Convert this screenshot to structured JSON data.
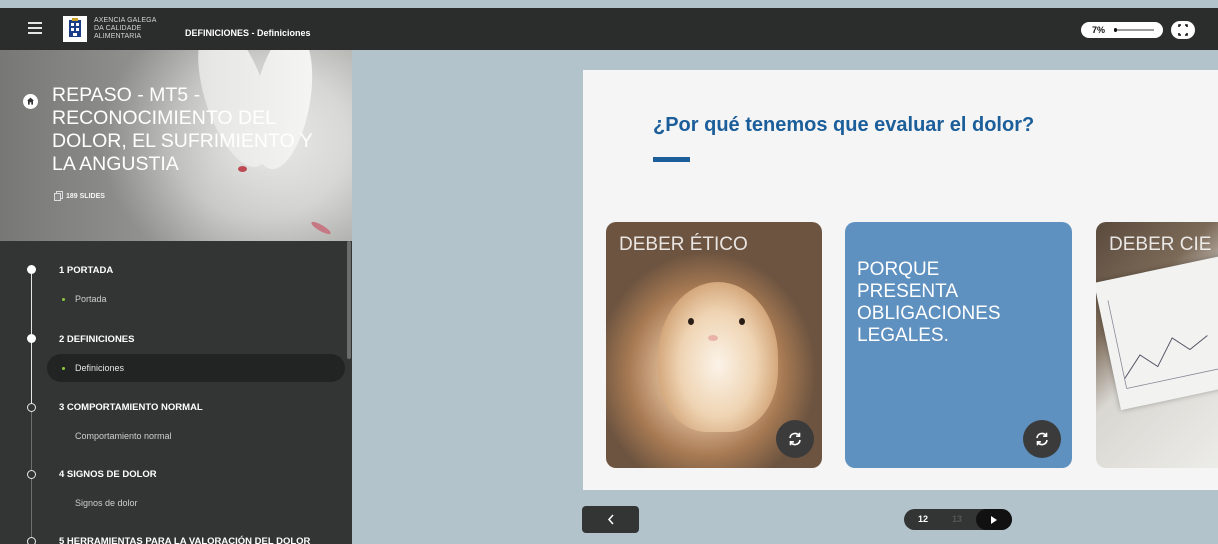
{
  "window": {
    "logo_text": [
      "AXENCIA GALEGA",
      "DA CALIDADE",
      "ALIMENTARIA"
    ],
    "title": "DEFINICIONES - Definiciones",
    "progress_label": "7%",
    "progress_value": 0.07
  },
  "sidebar": {
    "course_title": "REPASO - MT5 - RECONOCIMIENTO DEL DOLOR, EL SUFRIMIENTO Y LA ANGUSTIA",
    "slides_count": "189 SLIDES",
    "sections": [
      {
        "label": "1 PORTADA",
        "items": [
          {
            "label": "Portada",
            "state": "done"
          }
        ],
        "state": "done"
      },
      {
        "label": "2 DEFINICIONES",
        "items": [
          {
            "label": "Definiciones",
            "state": "active"
          }
        ],
        "state": "done"
      },
      {
        "label": "3 COMPORTAMIENTO NORMAL",
        "items": [
          {
            "label": "Comportamiento normal",
            "state": "pending"
          }
        ],
        "state": "pending"
      },
      {
        "label": "4 SIGNOS DE DOLOR",
        "items": [
          {
            "label": "Signos de dolor",
            "state": "pending"
          }
        ],
        "state": "pending"
      },
      {
        "label": "5 HERRAMIENTAS PARA LA VALORACIÓN DEL DOLOR",
        "items": [],
        "state": "pending"
      }
    ]
  },
  "slide": {
    "title": "¿Por qué tenemos que evaluar el dolor?",
    "cards": [
      {
        "heading": "DEBER ÉTICO",
        "image": "hamster-photo",
        "face": "front"
      },
      {
        "body": "PORQUE PRESENTA OBLIGACIONES LEGALES.",
        "face": "back"
      },
      {
        "heading": "DEBER CIE",
        "image": "chart-paper-photo",
        "face": "front"
      }
    ]
  },
  "pager": {
    "current": "12",
    "next": "13"
  },
  "colors": {
    "topbar": "#2b2c2c",
    "sidebar": "#333434",
    "title_blue": "#1b5e9a",
    "card_blue": "#5e90c0",
    "bullet_green": "#8ec63f",
    "stage": "#b3c3cc"
  },
  "icons": {
    "menu": "hamburger-icon",
    "fullscreen": "expand-icon",
    "home": "home-icon",
    "slides": "copy-icon",
    "flip": "refresh-icon",
    "prev": "chevron-left-icon",
    "play": "play-icon"
  }
}
